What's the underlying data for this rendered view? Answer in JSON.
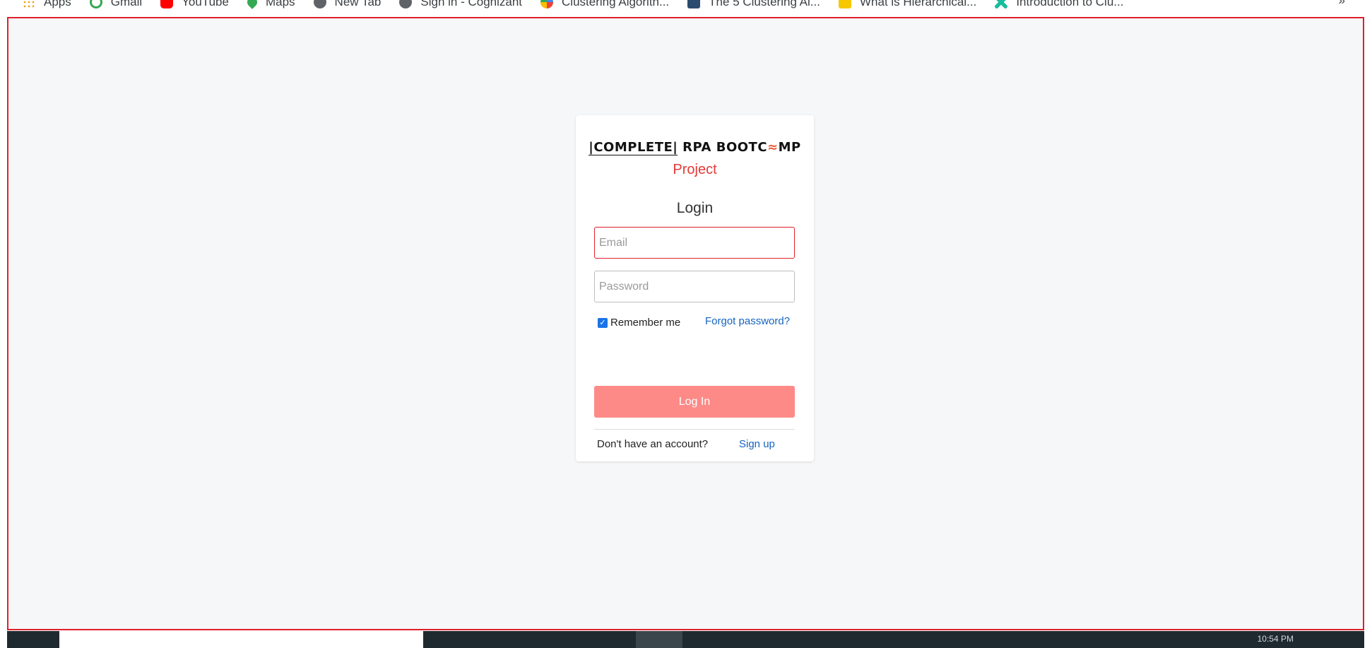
{
  "bookmarks": [
    {
      "label": "Apps",
      "icon": "apps-grid-icon",
      "color": "#e8a317"
    },
    {
      "label": "Gmail",
      "icon": "google-icon",
      "color": "#34a853"
    },
    {
      "label": "YouTube",
      "icon": "youtube-icon",
      "color": "#ff0000"
    },
    {
      "label": "Maps",
      "icon": "maps-pin-icon",
      "color": "#34a853"
    },
    {
      "label": "New Tab",
      "icon": "globe-icon",
      "color": "#5f6368"
    },
    {
      "label": "Sign in - Cognizant",
      "icon": "globe-icon",
      "color": "#5f6368"
    },
    {
      "label": "Clustering Algorith...",
      "icon": "multicolor-dots-icon",
      "color": "#fbbc04"
    },
    {
      "label": "The 5 Clustering Al...",
      "icon": "site-favicon-icon",
      "color": "#2c4a6e"
    },
    {
      "label": "What is Hierarchical...",
      "icon": "k-favicon-icon",
      "color": "#f7c800"
    },
    {
      "label": "Introduction to Clu...",
      "icon": "x-favicon-icon",
      "color": "#1abc9c"
    }
  ],
  "bookmarks_more": "»",
  "card": {
    "logo_bracket": "|COMPLETE|",
    "logo_rest_a": " RPA BOOTC",
    "logo_chevron": "≈",
    "logo_rest_b": "MP",
    "subtitle": "Project",
    "title": "Login"
  },
  "form": {
    "email_placeholder": "Email",
    "email_value": "",
    "password_placeholder": "Password",
    "password_value": "",
    "remember_label": "Remember me",
    "remember_checked": true,
    "forgot_label": "Forgot password?",
    "login_label": "Log In",
    "no_account_text": "Don't have an account?",
    "signup_label": "Sign up"
  },
  "taskbar": {
    "right_text": "10:54 PM"
  },
  "colors": {
    "accent_red": "#e53935",
    "link_blue": "#1565c0",
    "login_button": "#fe8a87",
    "page_background": "#f6f7f9",
    "frame_border": "#e0202a"
  }
}
